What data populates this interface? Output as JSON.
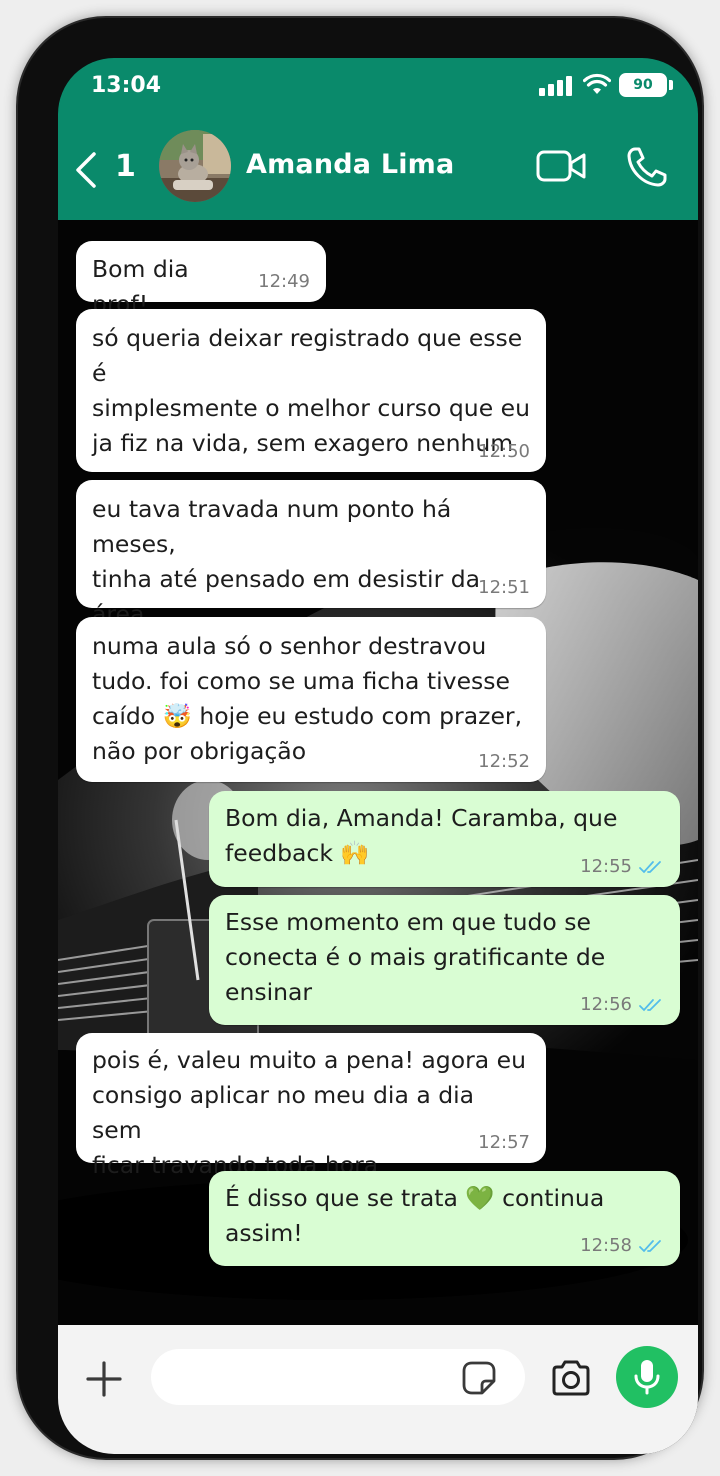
{
  "status_bar": {
    "time": "13:04",
    "battery": "90"
  },
  "header": {
    "back_count": "1",
    "contact_name": "Amanda Lima",
    "bg_color": "#0a8a6b"
  },
  "messages": [
    {
      "direction": "in",
      "text": "Bom dia prof!",
      "time": "12:49"
    },
    {
      "direction": "in",
      "text": "só queria deixar registrado que esse é\nsimplesmente o melhor curso que eu\nja fiz na vida, sem exagero nenhum",
      "time": "12:50"
    },
    {
      "direction": "in",
      "text": "eu tava travada num ponto há meses,\ntinha até pensado em desistir da área",
      "time": "12:51"
    },
    {
      "direction": "in",
      "text": "numa aula só o senhor destravou\ntudo. foi como se uma ficha tivesse\ncaído 🤯 hoje eu estudo com prazer,\nnão por obrigação",
      "time": "12:52"
    },
    {
      "direction": "out",
      "text": "Bom dia, Amanda! Caramba, que\nfeedback 🙌",
      "time": "12:55",
      "read": true
    },
    {
      "direction": "out",
      "text": "Esse momento em que tudo se\nconecta é o mais gratificante de\nensinar",
      "time": "12:56",
      "read": true
    },
    {
      "direction": "in",
      "text": "pois é, valeu muito a pena! agora eu\nconsigo aplicar no meu dia a dia sem\nficar travando toda hora",
      "time": "12:57"
    },
    {
      "direction": "out",
      "text": "É disso que se trata 💚 continua\nassim!",
      "time": "12:58",
      "read": true
    }
  ],
  "input_bar": {
    "placeholder": "",
    "accent": "#21c063"
  },
  "icons": {
    "back": "chevron-left-icon",
    "video": "video-camera-icon",
    "call": "phone-icon",
    "add": "plus-icon",
    "sticker": "sticker-icon",
    "camera": "camera-icon",
    "mic": "microphone-icon",
    "read_receipt": "double-check-icon"
  },
  "colors": {
    "incoming": "#ffffff",
    "outgoing": "#d9fdd3",
    "read_tick": "#53bdeb"
  }
}
